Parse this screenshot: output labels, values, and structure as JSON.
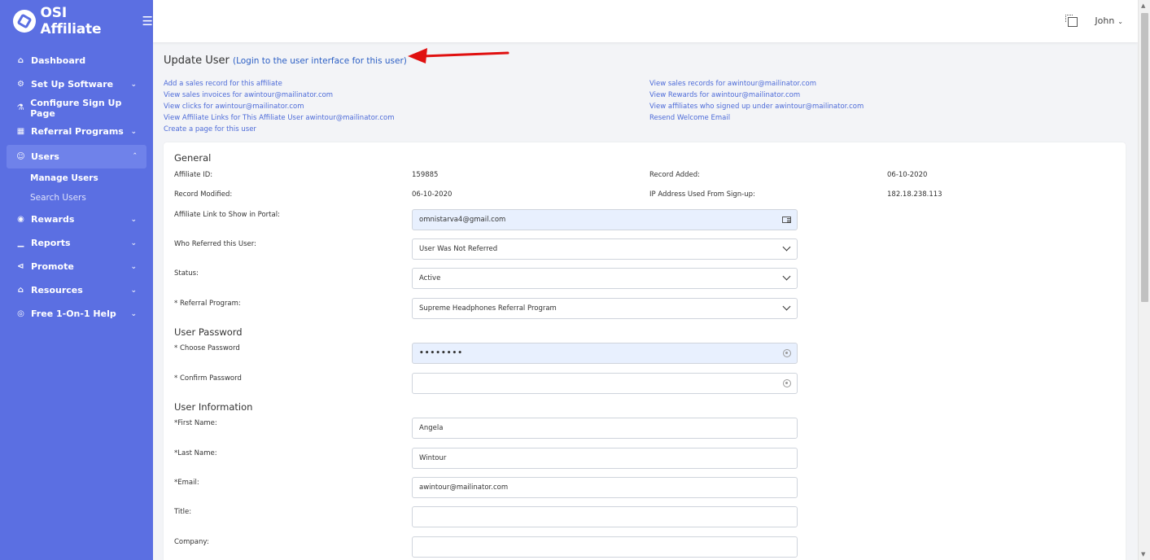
{
  "app": {
    "name": "OSI Affiliate",
    "menu_icon": "hamburger-icon"
  },
  "sidebar": {
    "items": [
      {
        "label": "Dashboard",
        "icon": "home-icon",
        "has_chevron": false
      },
      {
        "label": "Set Up Software",
        "icon": "gear-icon",
        "has_chevron": true
      },
      {
        "label": "Configure Sign Up Page",
        "icon": "flask-icon",
        "has_chevron": false
      },
      {
        "label": "Referral Programs",
        "icon": "gift-icon",
        "has_chevron": true
      },
      {
        "label": "Users",
        "icon": "user-icon",
        "has_chevron": true,
        "active": true
      },
      {
        "label": "Rewards",
        "icon": "globe-icon",
        "has_chevron": true
      },
      {
        "label": "Reports",
        "icon": "bar-chart-icon",
        "has_chevron": true
      },
      {
        "label": "Promote",
        "icon": "share-icon",
        "has_chevron": true
      },
      {
        "label": "Resources",
        "icon": "bank-icon",
        "has_chevron": true
      },
      {
        "label": "Free 1-On-1 Help",
        "icon": "lifebuoy-icon",
        "has_chevron": true
      }
    ],
    "users_sub": [
      "Manage Users",
      "Search Users"
    ]
  },
  "topbar": {
    "user_name": "John"
  },
  "page": {
    "title": "Update User",
    "login_link": "(Login to the user interface for this user)",
    "links_left": [
      "Add a sales record for this affiliate",
      "View sales invoices for awintour@mailinator.com",
      "View clicks for awintour@mailinator.com",
      "View Affiliate Links for This Affiliate User awintour@mailinator.com",
      "Create a page for this user"
    ],
    "links_right": [
      "View sales records for awintour@mailinator.com",
      "View Rewards for awintour@mailinator.com",
      "View affiliates who signed up under awintour@mailinator.com",
      "Resend Welcome Email"
    ]
  },
  "general": {
    "heading": "General",
    "affiliate_id_label": "Affiliate ID:",
    "affiliate_id": "159885",
    "record_added_label": "Record Added:",
    "record_added": "06-10-2020",
    "record_modified_label": "Record Modified:",
    "record_modified": "06-10-2020",
    "ip_label": "IP Address Used From Sign-up:",
    "ip": "182.18.238.113",
    "affiliate_link_label": "Affiliate Link to Show in Portal:",
    "affiliate_link": "omnistarva4@gmail.com",
    "referred_label": "Who Referred this User:",
    "referred": "User Was Not Referred",
    "status_label": "Status:",
    "status": "Active",
    "program_label": "* Referral Program:",
    "program": "Supreme Headphones Referral Program"
  },
  "password": {
    "heading": "User Password",
    "choose_label": "* Choose Password",
    "choose_value": "••••••••",
    "confirm_label": "* Confirm Password",
    "confirm_value": ""
  },
  "info": {
    "heading": "User Information",
    "first_name_label": "*First Name:",
    "first_name": "Angela",
    "last_name_label": "*Last Name:",
    "last_name": "Wintour",
    "email_label": "*Email:",
    "email": "awintour@mailinator.com",
    "title_label": "Title:",
    "title": "",
    "company_label": "Company:",
    "company": ""
  },
  "colors": {
    "sidebar": "#5b6fe2",
    "link": "#4d6bd8",
    "arrow": "#e01010"
  }
}
